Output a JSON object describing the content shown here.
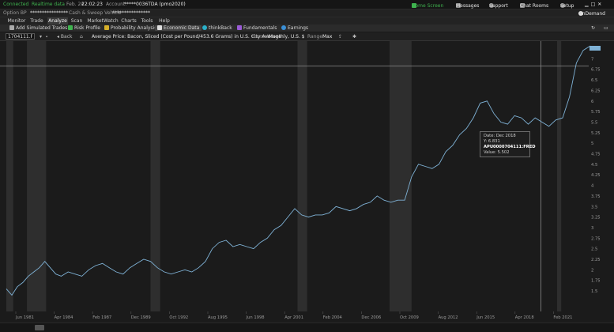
{
  "topbar": {
    "connected": "Connected",
    "realtime": "Realtime data",
    "datetime": "Feb. 24",
    "time": "22:02:23",
    "account_label": "Account:",
    "account_value": "*****0036TDA (pmo2020)",
    "home_screen": "Home Screen",
    "messages": "Messages",
    "support": "Support",
    "chat_rooms": "Chat Rooms",
    "setup": "Setup"
  },
  "acctbar": {
    "option_bp_label": "Option BP",
    "option_bp_value": "****************",
    "cash_label": "Cash & Sweep Vehicle",
    "cash_value": "****************",
    "on_demand": "OnDemand"
  },
  "tabs": [
    "Monitor",
    "Trade",
    "Analyze",
    "Scan",
    "MarketWatch",
    "Charts",
    "Tools",
    "Help"
  ],
  "tools": {
    "add_sim": "Add Simulated Trades",
    "risk": "Risk Profile",
    "prob": "Probability Analysis",
    "econ": "Economic Data",
    "thinkback": "thinkBack",
    "fundamentals": "Fundamentals",
    "earnings": "Earnings"
  },
  "symbar": {
    "symbol": "1704111.FRED",
    "back": "Back",
    "title": "Average Price: Bacon, Sliced (Cost per Pound/453.6 Grams) in U.S. City Average",
    "format_label": "Format:",
    "format_value": "Monthly, U.S. $",
    "range_label": "Range:",
    "range_value": "Max"
  },
  "tooltip": {
    "date_label": "Date:",
    "date_value": "Dec 2018",
    "y_label": "Y:",
    "y_value": "6.831",
    "series_id": "APU0000704111:FRED",
    "value_label": "Value:",
    "value_value": "5.502"
  },
  "chart_data": {
    "type": "line",
    "y_ticks": [
      "7.25",
      "7",
      "6.75",
      "6.5",
      "6.25",
      "6",
      "5.75",
      "5.5",
      "5.25",
      "5",
      "4.75",
      "4.5",
      "4.25",
      "4",
      "3.75",
      "3.5",
      "3.25",
      "3",
      "2.75",
      "2.5",
      "2.25",
      "2",
      "1.75",
      "1.5"
    ],
    "x_ticks": [
      "Jun 1981",
      "Apr 1984",
      "Feb 1987",
      "Dec 1989",
      "Oct 1992",
      "Aug 1995",
      "Jun 1998",
      "Apr 2001",
      "Feb 2004",
      "Dec 2006",
      "Oct 2009",
      "Aug 2012",
      "Jun 2015",
      "Apr 2018",
      "Feb 2021"
    ],
    "ylim": [
      1.25,
      7.5
    ],
    "crosshair_y": 6.831,
    "crosshair_date": 2018.92,
    "recessions": [
      [
        1980.0,
        1980.5
      ],
      [
        1981.5,
        1982.9
      ],
      [
        1990.5,
        1991.2
      ],
      [
        2001.2,
        2001.9
      ],
      [
        2007.9,
        2009.5
      ],
      [
        2020.1,
        2020.4
      ]
    ],
    "series": [
      {
        "x": [
          1980.0,
          1980.4,
          1980.8,
          1981.2,
          1981.6,
          1982.0,
          1982.4,
          1982.8,
          1983.2,
          1983.6,
          1984.0,
          1984.5,
          1985.0,
          1985.5,
          1986.0,
          1986.5,
          1987.0,
          1987.5,
          1988.0,
          1988.5,
          1989.0,
          1989.5,
          1990.0,
          1990.5,
          1991.0,
          1991.5,
          1992.0,
          1992.5,
          1993.0,
          1993.5,
          1994.0,
          1994.5,
          1995.0,
          1995.5,
          1996.0,
          1996.5,
          1997.0,
          1997.5,
          1998.0,
          1998.5,
          1999.0,
          1999.5,
          2000.0,
          2000.5,
          2001.0,
          2001.5,
          2002.0,
          2002.5,
          2003.0,
          2003.5,
          2004.0,
          2004.5,
          2005.0,
          2005.5,
          2006.0,
          2006.5,
          2007.0,
          2007.5,
          2008.0,
          2008.5,
          2009.0,
          2009.5,
          2010.0,
          2010.5,
          2011.0,
          2011.5,
          2012.0,
          2012.5,
          2013.0,
          2013.5,
          2014.0,
          2014.5,
          2015.0,
          2015.5,
          2016.0,
          2016.5,
          2017.0,
          2017.5,
          2018.0,
          2018.5,
          2019.0,
          2019.5,
          2020.0,
          2020.5,
          2021.0,
          2021.5,
          2022.0,
          2022.5,
          2023.0
        ],
        "y": [
          1.55,
          1.4,
          1.6,
          1.7,
          1.85,
          1.95,
          2.05,
          2.2,
          2.05,
          1.9,
          1.85,
          1.95,
          1.9,
          1.85,
          2.0,
          2.1,
          2.15,
          2.05,
          1.95,
          1.9,
          2.05,
          2.15,
          2.25,
          2.2,
          2.05,
          1.95,
          1.9,
          1.95,
          2.0,
          1.95,
          2.05,
          2.2,
          2.5,
          2.65,
          2.7,
          2.55,
          2.6,
          2.55,
          2.5,
          2.65,
          2.75,
          2.95,
          3.05,
          3.25,
          3.45,
          3.3,
          3.25,
          3.3,
          3.3,
          3.35,
          3.5,
          3.45,
          3.4,
          3.45,
          3.55,
          3.6,
          3.75,
          3.65,
          3.6,
          3.65,
          3.65,
          4.2,
          4.5,
          4.45,
          4.4,
          4.5,
          4.8,
          4.95,
          5.2,
          5.35,
          5.6,
          5.95,
          6.0,
          5.7,
          5.5,
          5.45,
          5.65,
          5.6,
          5.45,
          5.6,
          5.5,
          5.4,
          5.55,
          5.6,
          6.1,
          6.9,
          7.2,
          7.3,
          7.25
        ]
      }
    ]
  }
}
